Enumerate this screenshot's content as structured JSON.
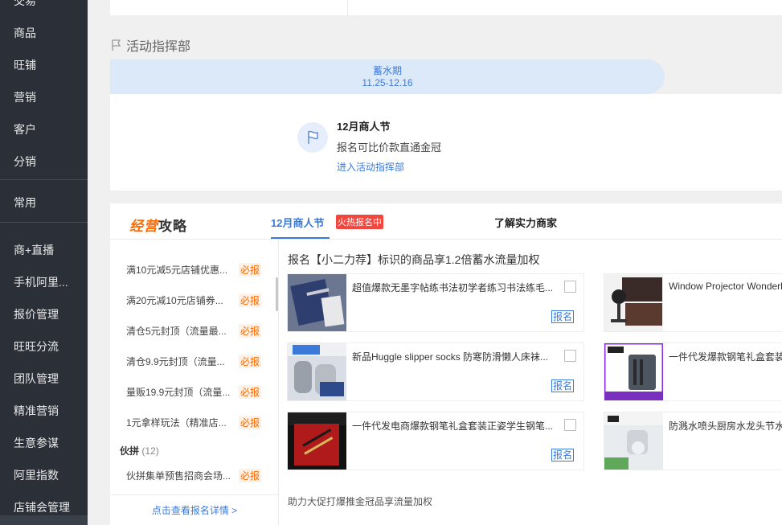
{
  "sidebar": {
    "items": [
      "交易",
      "商品",
      "旺铺",
      "营销",
      "客户",
      "分销",
      "常用",
      "商+直播",
      "手机阿里...",
      "报价管理",
      "旺旺分流",
      "团队管理",
      "精准营销",
      "生意参谋",
      "阿里指数",
      "店铺会管理"
    ]
  },
  "section": {
    "title": "活动指挥部"
  },
  "phase": {
    "name": "蓄水期",
    "date": "11.25-12.16"
  },
  "event": {
    "title": "12月商人节",
    "desc": "报名可比价款直通金冠",
    "link": "进入活动指挥部"
  },
  "strategy": {
    "logo_part1": "经营",
    "logo_part2": "攻略",
    "tab_active": "12月商人节",
    "tab_badge": "火热报名中",
    "tab_other": "了解实力商家",
    "must_label": "必报",
    "list": [
      {
        "text": "满10元减5元店铺优惠..."
      },
      {
        "text": "满20元减10元店铺券..."
      },
      {
        "text": "清仓5元封顶（流量最..."
      },
      {
        "text": "清仓9.9元封顶（流量..."
      },
      {
        "text": "量贩19.9元封顶（流量..."
      },
      {
        "text": "1元拿样玩法（精准店..."
      }
    ],
    "group": {
      "name": "伙拼",
      "count": "(12)"
    },
    "group_item": "伙拼集单预售招商会场...",
    "left_footer": "点击查看报名详情 >",
    "right_title": "报名【小二力荐】标识的商品享1.2倍蓄水流量加权",
    "apply_label": "报名",
    "products_left": [
      {
        "name": "超值爆款无墨字帖练书法初学者练习书法练毛..."
      },
      {
        "name": "新品Huggle slipper socks 防寒防滑懒人床袜..."
      },
      {
        "name": "一件代发电商爆款钢笔礼盒套装正姿学生钢笔..."
      }
    ],
    "products_right": [
      {
        "name": "Window Projector Wonderland"
      },
      {
        "name": "一件代发爆款钢笔礼盒套装"
      },
      {
        "name": "防溅水喷头厨房水龙头节水"
      }
    ],
    "right_footer": "助力大促打爆推金冠品享流量加权"
  }
}
